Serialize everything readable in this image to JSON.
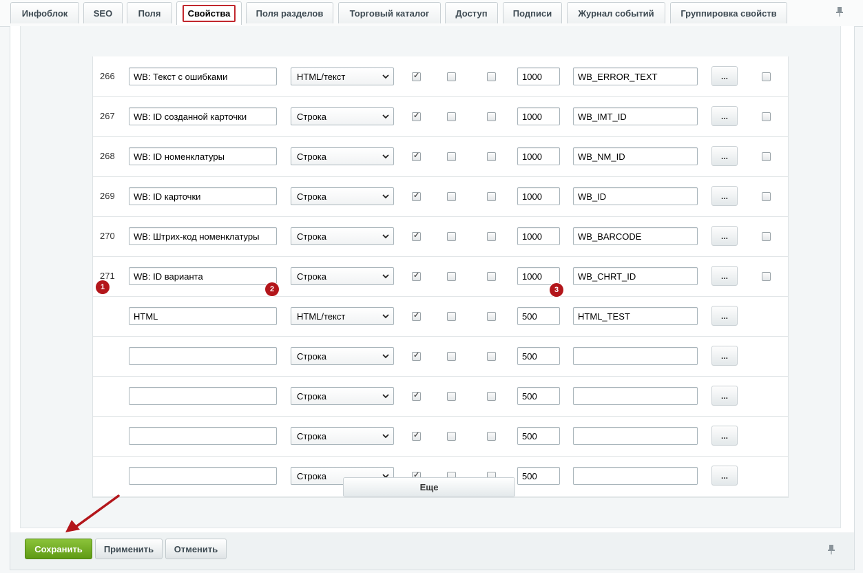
{
  "tabs": [
    {
      "label": "Инфоблок",
      "active": false
    },
    {
      "label": "SEO",
      "active": false
    },
    {
      "label": "Поля",
      "active": false
    },
    {
      "label": "Свойства",
      "active": true
    },
    {
      "label": "Поля разделов",
      "active": false
    },
    {
      "label": "Торговый каталог",
      "active": false
    },
    {
      "label": "Доступ",
      "active": false
    },
    {
      "label": "Подписи",
      "active": false
    },
    {
      "label": "Журнал событий",
      "active": false
    },
    {
      "label": "Группировка свойств",
      "active": false
    }
  ],
  "rows": [
    {
      "id": "266",
      "name": "WB: Текст с ошибками",
      "type": "HTML/текст",
      "active": true,
      "multiple": false,
      "required": false,
      "sort": "1000",
      "code": "WB_ERROR_TEXT",
      "more": "...",
      "delete": false
    },
    {
      "id": "267",
      "name": "WB: ID созданной карточки",
      "type": "Строка",
      "active": true,
      "multiple": false,
      "required": false,
      "sort": "1000",
      "code": "WB_IMT_ID",
      "more": "...",
      "delete": false
    },
    {
      "id": "268",
      "name": "WB: ID номенклатуры",
      "type": "Строка",
      "active": true,
      "multiple": false,
      "required": false,
      "sort": "1000",
      "code": "WB_NM_ID",
      "more": "...",
      "delete": false
    },
    {
      "id": "269",
      "name": "WB: ID карточки",
      "type": "Строка",
      "active": true,
      "multiple": false,
      "required": false,
      "sort": "1000",
      "code": "WB_ID",
      "more": "...",
      "delete": false
    },
    {
      "id": "270",
      "name": "WB: Штрих-код номенклатуры",
      "type": "Строка",
      "active": true,
      "multiple": false,
      "required": false,
      "sort": "1000",
      "code": "WB_BARCODE",
      "more": "...",
      "delete": false
    },
    {
      "id": "271",
      "name": "WB: ID варианта",
      "type": "Строка",
      "active": true,
      "multiple": false,
      "required": false,
      "sort": "1000",
      "code": "WB_CHRT_ID",
      "more": "...",
      "delete": false
    },
    {
      "id": "",
      "name": "HTML",
      "type": "HTML/текст",
      "active": true,
      "multiple": false,
      "required": false,
      "sort": "500",
      "code": "HTML_TEST",
      "more": "...",
      "new": true
    },
    {
      "id": "",
      "name": "",
      "type": "Строка",
      "active": true,
      "multiple": false,
      "required": false,
      "sort": "500",
      "code": "",
      "more": "...",
      "new": true
    },
    {
      "id": "",
      "name": "",
      "type": "Строка",
      "active": true,
      "multiple": false,
      "required": false,
      "sort": "500",
      "code": "",
      "more": "...",
      "new": true
    },
    {
      "id": "",
      "name": "",
      "type": "Строка",
      "active": true,
      "multiple": false,
      "required": false,
      "sort": "500",
      "code": "",
      "more": "...",
      "new": true
    },
    {
      "id": "",
      "name": "",
      "type": "Строка",
      "active": true,
      "multiple": false,
      "required": false,
      "sort": "500",
      "code": "",
      "more": "...",
      "new": true
    }
  ],
  "badges": [
    "1",
    "2",
    "3"
  ],
  "more_button": "Еще",
  "footer": {
    "save": "Сохранить",
    "apply": "Применить",
    "cancel": "Отменить"
  },
  "icons": {
    "pin": "pin-icon",
    "arrow": "red-arrow-annotation"
  },
  "colors": {
    "highlight": "#c1272d",
    "save_green": "#6fa81f",
    "badge": "#b3161b"
  }
}
